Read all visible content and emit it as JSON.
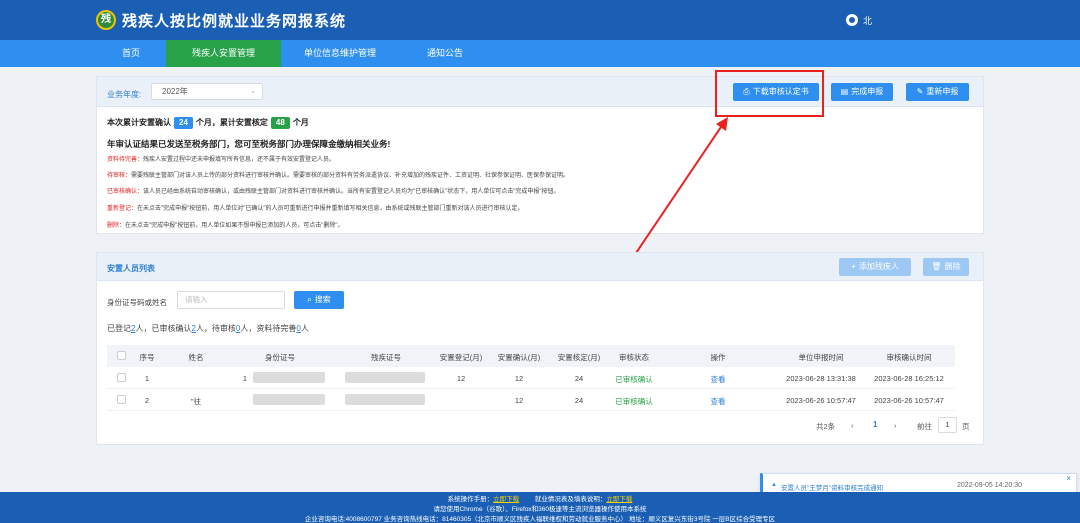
{
  "app": {
    "title": "残疾人按比例就业业务网报系统",
    "logo_char": "残",
    "user_name": "北"
  },
  "nav": [
    "首页",
    "残疾人安置管理",
    "单位信息维护管理",
    "通知公告"
  ],
  "business": {
    "year_label": "业务年度:",
    "year_value": "2022年",
    "buttons": {
      "download": "下载审核认定书",
      "complete": "完成申报",
      "redo": "重新申报"
    },
    "stat_prefix": "本次累计安置确认",
    "confirm_count": "24",
    "stat_mid": "个月，累计安置核定",
    "verify_count": "48",
    "stat_suffix": "个月",
    "notice": "年审认证结果已发送至税务部门，您可至税务部门办理保障金缴纳相关业务!",
    "descs": [
      {
        "k": "资料待完善：",
        "v": "残疾人安置过程中还未申报填写所有信息，还不属于有效安置登记人员。"
      },
      {
        "k": "待审核：",
        "v": "需要残联主管部门对该人员上传的部分资料进行审核并确认。需要审核的部分资料有劳务派遣协议、补充增加的残疾证件、工资证明、社保参保证明、医保参保证明。"
      },
      {
        "k": "已审核确认：",
        "v": "该人员已经由系统自动审核确认，或由残联主管部门对资料进行审核并确认。当所有安置登记人员均为\"已审核确认\"状态下，用人单位可点击\"完成申报\"按钮。"
      },
      {
        "k": "重新登记：",
        "v": "在未点击\"完成申报\"按钮前，用人单位对\"已确认\"的人员可重新进行申报并重新填写相关信息，由系统或残联主管部门重新对该人员进行审核认定。"
      },
      {
        "k": "删除：",
        "v": "在未点击\"完成申报\"按钮前，用人单位如果不想申报已添加的人员，可点击\"删除\"。"
      }
    ]
  },
  "list": {
    "title": "安置人员列表",
    "add_btn": "添加残疾人",
    "delete_btn": "删除",
    "search_label": "身份证号码或姓名",
    "search_placeholder": "请输入",
    "search_btn": "搜索",
    "summary": {
      "p1": "已登记",
      "n1": "2",
      "p2": "人，已审核确认",
      "n2": "2",
      "p3": "人，待审核",
      "n3": "0",
      "p4": "人，资料待完善",
      "n4": "0",
      "p5": "人"
    },
    "columns": [
      "序号",
      "姓名",
      "身份证号",
      "残疾证号",
      "安置登记(月)",
      "安置确认(月)",
      "安置核定(月)",
      "审核状态",
      "操作",
      "单位申报时间",
      "审核确认时间"
    ],
    "rows": [
      {
        "no": "1",
        "name": "",
        "id": "1",
        "disab": "",
        "reg": "12",
        "conf": "12",
        "verify": "24",
        "status": "已审核确认",
        "action": "查看",
        "apply_time": "2023-06-28 13:31:38",
        "confirm_time": "2023-06-28 16:25:12"
      },
      {
        "no": "2",
        "name": "\"往",
        "id": "",
        "disab": "",
        "reg": "",
        "conf": "12",
        "verify": "24",
        "status": "已审核确认",
        "action": "查看",
        "apply_time": "2023-06-26 10:57:47",
        "confirm_time": "2023-06-26 10:57:47"
      }
    ],
    "pager": {
      "total": "共2条",
      "prev": "‹",
      "current": "1",
      "next": "›",
      "goto": "前往",
      "page": "1",
      "unit": "页"
    }
  },
  "toast": {
    "text": "安置人员\"王梦月\"资料审核完成通知",
    "time": "2022-09-05 14:20:30",
    "close": "×"
  },
  "footer": {
    "l1a": "系统操作手册：",
    "l1b": "立即下载",
    "l1c": "就业情况表及填表说明：",
    "l1d": "立即下载",
    "l2": "请您使用Chrome（谷歌）、Firefox和360极速等主流浏览器操作使用本系统",
    "l3": "企业咨询电话:4008600797 业务咨询热线电话：81460305（北京市顺义区残疾人福联维权和劳动就业服务中心） 地址：顺义区复兴东街3号院 一层B区综合受理专区"
  }
}
